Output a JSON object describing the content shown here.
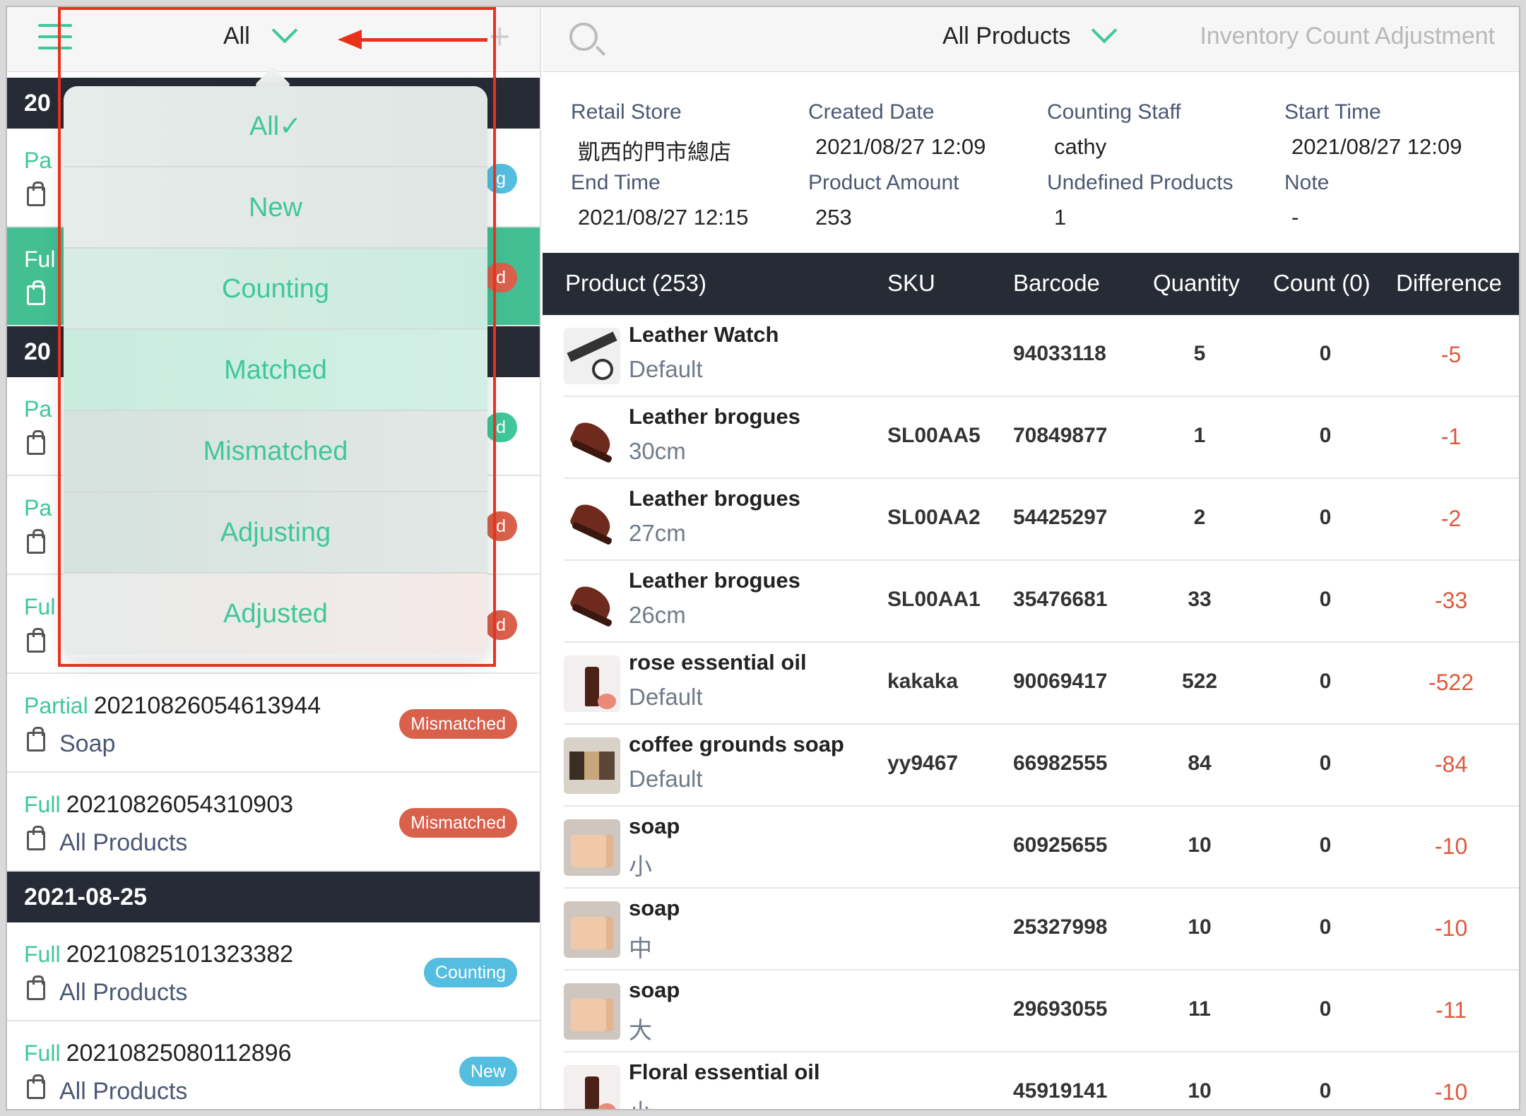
{
  "left_header": {
    "filter_title": "All"
  },
  "date_headers": [
    "20",
    "20",
    "2021-08-25"
  ],
  "list_rows": [
    {
      "type": "Pa",
      "code": "",
      "store": "",
      "badge": "g",
      "badge_type": "counting",
      "selected": false
    },
    {
      "type": "Ful",
      "code": "",
      "store": "",
      "badge": "d",
      "badge_type": "mismatched",
      "selected": true
    },
    {
      "type": "Pa",
      "code": "",
      "store": "",
      "badge": "d",
      "badge_type": "matched",
      "selected": false
    },
    {
      "type": "Pa",
      "code": "",
      "store": "",
      "badge": "d",
      "badge_type": "mismatched",
      "selected": false
    },
    {
      "type": "Ful",
      "code": "",
      "store": "",
      "badge": "d",
      "badge_type": "mismatched",
      "selected": false
    },
    {
      "type": "Partial",
      "code": "20210826054613944",
      "store": "Soap",
      "badge": "Mismatched",
      "badge_type": "mismatched",
      "selected": false
    },
    {
      "type": "Full",
      "code": "20210826054310903",
      "store": "All Products",
      "badge": "Mismatched",
      "badge_type": "mismatched",
      "selected": false
    },
    {
      "type": "Full",
      "code": "20210825101323382",
      "store": "All Products",
      "badge": "Counting",
      "badge_type": "counting",
      "selected": false
    },
    {
      "type": "Full",
      "code": "20210825080112896",
      "store": "All Products",
      "badge": "New",
      "badge_type": "new",
      "selected": false
    }
  ],
  "dropdown_options": [
    "All✓",
    "New",
    "Counting",
    "Matched",
    "Mismatched",
    "Adjusting",
    "Adjusted"
  ],
  "right_header": {
    "title": "All Products",
    "action": "Inventory Count Adjustment"
  },
  "info": {
    "retail_store_label": "Retail Store",
    "retail_store": "凱西的門市總店",
    "created_date_label": "Created Date",
    "created_date": "2021/08/27 12:09",
    "counting_staff_label": "Counting Staff",
    "counting_staff": "cathy",
    "start_time_label": "Start Time",
    "start_time": "2021/08/27 12:09",
    "end_time_label": "End Time",
    "end_time": "2021/08/27 12:15",
    "product_amount_label": "Product Amount",
    "product_amount": "253",
    "undefined_products_label": "Undefined Products",
    "undefined_products": "1",
    "note_label": "Note",
    "note": "-"
  },
  "table_headers": {
    "product": "Product (253)",
    "sku": "SKU",
    "barcode": "Barcode",
    "quantity": "Quantity",
    "count": "Count (0)",
    "difference": "Difference"
  },
  "products": [
    {
      "name": "Leather Watch",
      "variant": "Default",
      "sku": "",
      "barcode": "94033118",
      "quantity": "5",
      "count": "0",
      "difference": "-5",
      "thumb": "watch"
    },
    {
      "name": "Leather brogues",
      "variant": "30cm",
      "sku": "SL00AA5",
      "barcode": "70849877",
      "quantity": "1",
      "count": "0",
      "difference": "-1",
      "thumb": "shoe"
    },
    {
      "name": "Leather brogues",
      "variant": "27cm",
      "sku": "SL00AA2",
      "barcode": "54425297",
      "quantity": "2",
      "count": "0",
      "difference": "-2",
      "thumb": "shoe"
    },
    {
      "name": "Leather brogues",
      "variant": "26cm",
      "sku": "SL00AA1",
      "barcode": "35476681",
      "quantity": "33",
      "count": "0",
      "difference": "-33",
      "thumb": "shoe"
    },
    {
      "name": "rose essential oil",
      "variant": "Default",
      "sku": "kakaka",
      "barcode": "90069417",
      "quantity": "522",
      "count": "0",
      "difference": "-522",
      "thumb": "oil"
    },
    {
      "name": "coffee grounds soap",
      "variant": "Default",
      "sku": "yy9467",
      "barcode": "66982555",
      "quantity": "84",
      "count": "0",
      "difference": "-84",
      "thumb": "coffee"
    },
    {
      "name": "soap",
      "variant": "小",
      "sku": "",
      "barcode": "60925655",
      "quantity": "10",
      "count": "0",
      "difference": "-10",
      "thumb": "soap"
    },
    {
      "name": "soap",
      "variant": "中",
      "sku": "",
      "barcode": "25327998",
      "quantity": "10",
      "count": "0",
      "difference": "-10",
      "thumb": "soap"
    },
    {
      "name": "soap",
      "variant": "大",
      "sku": "",
      "barcode": "29693055",
      "quantity": "11",
      "count": "0",
      "difference": "-11",
      "thumb": "soap"
    },
    {
      "name": "Floral essential oil",
      "variant": "小",
      "sku": "",
      "barcode": "45919141",
      "quantity": "10",
      "count": "0",
      "difference": "-10",
      "thumb": "oil"
    }
  ],
  "colors": {
    "accent": "#3fc79a",
    "header_dark": "#262b35",
    "mismatched": "#d9604a",
    "counting": "#54bde0",
    "difference": "#e0583c",
    "annotation": "#e8321e"
  }
}
